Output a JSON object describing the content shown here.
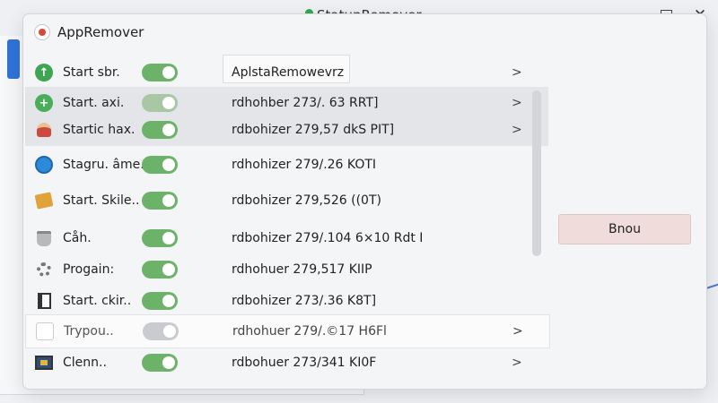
{
  "titlebar": {
    "title": "StatupRemover"
  },
  "window": {
    "app_title": "AppRemover"
  },
  "header": {
    "value_col": "AplstaRemowevrz"
  },
  "rows": [
    {
      "label": "Start⁢ sbr.",
      "value": "",
      "icon": "arrow-up-icon",
      "toggle": "on"
    },
    {
      "label": "Start. axi.",
      "value": "rdhohber 273/. 63 RRT]",
      "icon": "plus-circle-icon",
      "toggle": "dim"
    },
    {
      "label": "Startic hax.",
      "value": "rdbohizer 279,57 dkS PIT]",
      "icon": "person-icon",
      "toggle": "on"
    },
    {
      "label": "Stagru. âme..",
      "value": "rdhohizer 279/.26 KOTI",
      "icon": "globe-icon",
      "toggle": "on"
    },
    {
      "label": "Start. Skile..",
      "value": "rdbohizer 279,526 ((0T)",
      "icon": "box-icon",
      "toggle": "on"
    },
    {
      "label": "Cåh.",
      "value": "rdbohizer 279/.104 6×10 Rdt I",
      "icon": "pot-icon",
      "toggle": "on"
    },
    {
      "label": "Progain:",
      "value": "rdhohuer 279,517 KIIP",
      "icon": "gear-icon",
      "toggle": "on"
    },
    {
      "label": "Start. ckir..",
      "value": "rdbohizer 273/.36 K8T]",
      "icon": "document-icon",
      "toggle": "on"
    },
    {
      "label": "Trypou..",
      "value": "rdhohuer 279/.©17 H6Fl",
      "icon": "blank-icon",
      "toggle": "off"
    },
    {
      "label": "Clenn..",
      "value": "rdbohuer 273/341 KI0F",
      "icon": "monitor-icon",
      "toggle": "on"
    }
  ],
  "chevron": ">",
  "side_button": {
    "label": "Bnou"
  },
  "colors": {
    "toggle_on": "#6cb369",
    "toggle_off": "#c9cbce",
    "button_bg": "#f0dcda"
  }
}
